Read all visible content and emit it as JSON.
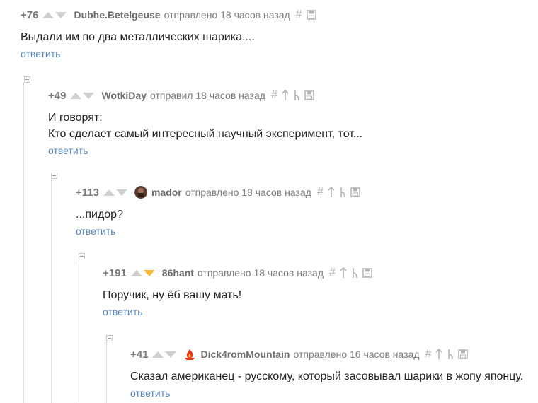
{
  "comments": [
    {
      "score": "+76",
      "author": "Dubhe.Betelgeuse",
      "meta": "отправлено 18 часов назад",
      "text": [
        "Выдали им по два металлических шарика...."
      ],
      "reply": "ответить",
      "down_active": false
    },
    {
      "score": "+49",
      "author": "WotkiDay",
      "meta": "отправил 18 часов назад",
      "text": [
        "И говорят:",
        "Кто сделает самый интересный научный эксперимент, тот..."
      ],
      "reply": "ответить",
      "down_active": false
    },
    {
      "score": "+113",
      "author": "mador",
      "meta": "отправлено 18 часов назад",
      "text": [
        "...пидор?"
      ],
      "reply": "ответить",
      "down_active": false
    },
    {
      "score": "+191",
      "author": "86hant",
      "meta": "отправлено 18 часов назад",
      "text": [
        "Поручик, ну ёб вашу мать!"
      ],
      "reply": "ответить",
      "down_active": true
    },
    {
      "score": "+41",
      "author": "Dick4romMountain",
      "meta": "отправлено 16 часов назад",
      "text": [
        "Сказал американец - русскому, который засовывал шарики в жопу японцу."
      ],
      "reply": "ответить",
      "down_active": false
    }
  ],
  "icons": {
    "permalink": "hash-icon",
    "parent": "arrow-up-icon",
    "branch": "branch-icon",
    "save": "save-icon"
  },
  "colors": {
    "link": "#5a86b3",
    "vote_inactive": "#cfcfcf",
    "vote_active": "#f5b93a"
  }
}
